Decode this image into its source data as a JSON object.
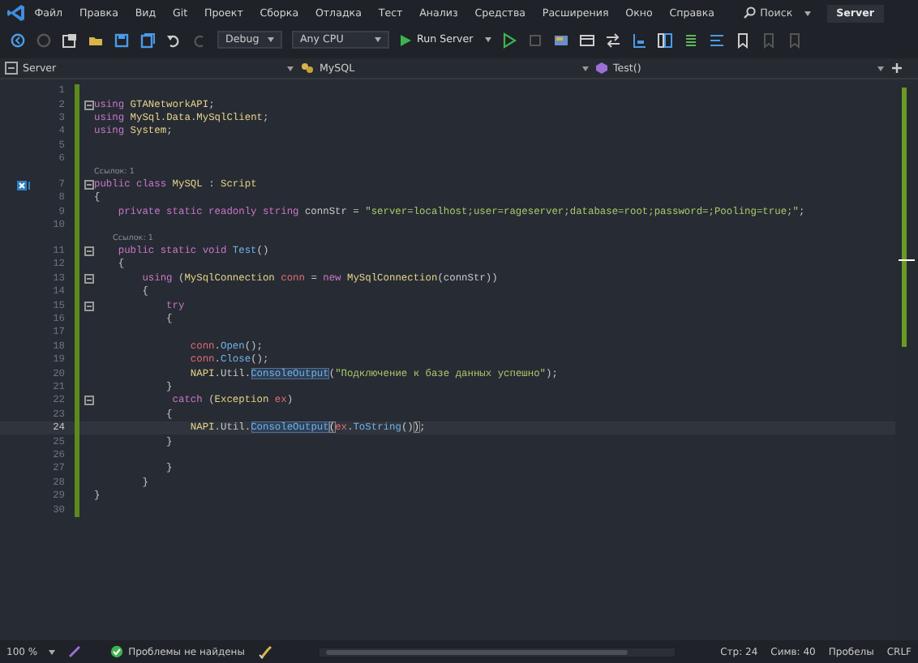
{
  "menu": [
    "Файл",
    "Правка",
    "Вид",
    "Git",
    "Проект",
    "Сборка",
    "Отладка",
    "Тест",
    "Анализ",
    "Средства",
    "Расширения",
    "Окно",
    "Справка"
  ],
  "search": {
    "label": "Поиск"
  },
  "solution_title": "Server",
  "toolbar": {
    "configuration": "Debug",
    "platform": "Any CPU",
    "run": "Run Server"
  },
  "navigation": {
    "project": "Server",
    "type": "MySQL",
    "member": "Test()"
  },
  "code_lines": [
    {
      "number": "1",
      "fold": false,
      "current": false
    },
    {
      "number": "2",
      "fold": true,
      "current": false,
      "tokens": [
        {
          "kind": "kw",
          "text": "using "
        },
        {
          "kind": "type",
          "text": "GTANetworkAPI"
        },
        {
          "kind": "punct",
          "text": ";"
        }
      ]
    },
    {
      "number": "3",
      "fold": false,
      "current": false,
      "tokens": [
        {
          "kind": "kw",
          "text": "using "
        },
        {
          "kind": "type",
          "text": "MySql"
        },
        {
          "kind": "punct",
          "text": "."
        },
        {
          "kind": "type",
          "text": "Data"
        },
        {
          "kind": "punct",
          "text": "."
        },
        {
          "kind": "type",
          "text": "MySqlClient"
        },
        {
          "kind": "punct",
          "text": ";"
        }
      ]
    },
    {
      "number": "4",
      "fold": false,
      "current": false,
      "tokens": [
        {
          "kind": "kw",
          "text": "using "
        },
        {
          "kind": "type",
          "text": "System"
        },
        {
          "kind": "punct",
          "text": ";"
        }
      ]
    },
    {
      "number": "5",
      "fold": false,
      "current": false
    },
    {
      "number": "6",
      "fold": false,
      "current": false
    },
    {
      "number": "7",
      "fold": true,
      "current": false,
      "lens": "Ссылок: 1",
      "marker": true,
      "tokens": [
        {
          "kind": "kw",
          "text": "public class "
        },
        {
          "kind": "type",
          "text": "MySQL"
        },
        {
          "kind": "punct",
          "text": " : "
        },
        {
          "kind": "type",
          "text": "Script"
        }
      ]
    },
    {
      "number": "8",
      "fold": false,
      "current": false,
      "tokens": [
        {
          "kind": "punct",
          "text": "{"
        }
      ]
    },
    {
      "number": "9",
      "fold": false,
      "current": false,
      "tokens": [
        {
          "kind": "kw",
          "text": "    private static readonly string "
        },
        {
          "kind": "field",
          "text": "connStr"
        },
        {
          "kind": "punct",
          "text": " = "
        },
        {
          "kind": "str",
          "text": "\"server=localhost;user=rageserver;database=root;password=;Pooling=true;\""
        },
        {
          "kind": "punct",
          "text": ";"
        }
      ]
    },
    {
      "number": "10",
      "fold": false,
      "current": false
    },
    {
      "number": "11",
      "fold": true,
      "current": false,
      "lens": "Ссылок: 1",
      "tokens": [
        {
          "kind": "kw",
          "text": "    public static void "
        },
        {
          "kind": "method",
          "text": "Test"
        },
        {
          "kind": "punct",
          "text": "()"
        }
      ]
    },
    {
      "number": "12",
      "fold": false,
      "current": false,
      "tokens": [
        {
          "kind": "punct",
          "text": "    {"
        }
      ]
    },
    {
      "number": "13",
      "fold": true,
      "current": false,
      "tokens": [
        {
          "kind": "kw",
          "text": "        using "
        },
        {
          "kind": "punct",
          "text": "("
        },
        {
          "kind": "type",
          "text": "MySqlConnection "
        },
        {
          "kind": "local",
          "text": "conn"
        },
        {
          "kind": "punct",
          "text": " = "
        },
        {
          "kind": "kw",
          "text": "new "
        },
        {
          "kind": "type",
          "text": "MySqlConnection"
        },
        {
          "kind": "punct",
          "text": "("
        },
        {
          "kind": "field",
          "text": "connStr"
        },
        {
          "kind": "punct",
          "text": "))"
        }
      ]
    },
    {
      "number": "14",
      "fold": false,
      "current": false,
      "tokens": [
        {
          "kind": "punct",
          "text": "        {"
        }
      ]
    },
    {
      "number": "15",
      "fold": true,
      "current": false,
      "tokens": [
        {
          "kind": "kw",
          "text": "            try"
        }
      ]
    },
    {
      "number": "16",
      "fold": false,
      "current": false,
      "tokens": [
        {
          "kind": "punct",
          "text": "            {"
        }
      ]
    },
    {
      "number": "17",
      "fold": false,
      "current": false
    },
    {
      "number": "18",
      "fold": false,
      "current": false,
      "tokens": [
        {
          "kind": "local",
          "text": "                conn"
        },
        {
          "kind": "punct",
          "text": "."
        },
        {
          "kind": "method",
          "text": "Open"
        },
        {
          "kind": "punct",
          "text": "();"
        }
      ]
    },
    {
      "number": "19",
      "fold": false,
      "current": false,
      "tokens": [
        {
          "kind": "local",
          "text": "                conn"
        },
        {
          "kind": "punct",
          "text": "."
        },
        {
          "kind": "method",
          "text": "Close"
        },
        {
          "kind": "punct",
          "text": "();"
        }
      ]
    },
    {
      "number": "20",
      "fold": false,
      "current": false,
      "tokens": [
        {
          "kind": "type",
          "text": "                NAPI"
        },
        {
          "kind": "punct",
          "text": "."
        },
        {
          "kind": "field",
          "text": "Util"
        },
        {
          "kind": "punct",
          "text": "."
        },
        {
          "kind": "ref",
          "text": "ConsoleOutput"
        },
        {
          "kind": "punct",
          "text": "("
        },
        {
          "kind": "str",
          "text": "\"Подключение к базе данных успешно\""
        },
        {
          "kind": "punct",
          "text": ");"
        }
      ]
    },
    {
      "number": "21",
      "fold": false,
      "current": false,
      "tokens": [
        {
          "kind": "punct",
          "text": "            }"
        }
      ]
    },
    {
      "number": "22",
      "fold": true,
      "current": false,
      "tokens": [
        {
          "kind": "kw",
          "text": "             catch "
        },
        {
          "kind": "punct",
          "text": "("
        },
        {
          "kind": "type",
          "text": "Exception "
        },
        {
          "kind": "local",
          "text": "ex"
        },
        {
          "kind": "punct",
          "text": ")"
        }
      ]
    },
    {
      "number": "23",
      "fold": false,
      "current": false,
      "tokens": [
        {
          "kind": "punct",
          "text": "            {"
        }
      ]
    },
    {
      "number": "24",
      "fold": false,
      "current": true,
      "tokens": [
        {
          "kind": "type",
          "text": "                NAPI"
        },
        {
          "kind": "punct",
          "text": "."
        },
        {
          "kind": "field",
          "text": "Util"
        },
        {
          "kind": "punct",
          "text": "."
        },
        {
          "kind": "ref",
          "text": "ConsoleOutput"
        },
        {
          "kind": "brace",
          "text": "("
        },
        {
          "kind": "local",
          "text": "ex"
        },
        {
          "kind": "punct",
          "text": "."
        },
        {
          "kind": "method",
          "text": "ToString"
        },
        {
          "kind": "punct",
          "text": "()"
        },
        {
          "kind": "brace",
          "text": ")"
        },
        {
          "kind": "punct",
          "text": ";"
        }
      ]
    },
    {
      "number": "25",
      "fold": false,
      "current": false,
      "tokens": [
        {
          "kind": "punct",
          "text": "            }"
        }
      ]
    },
    {
      "number": "26",
      "fold": false,
      "current": false
    },
    {
      "number": "27",
      "fold": false,
      "current": false,
      "tokens": [
        {
          "kind": "punct",
          "text": "            }"
        }
      ]
    },
    {
      "number": "28",
      "fold": false,
      "current": false,
      "tokens": [
        {
          "kind": "punct",
          "text": "        }"
        }
      ]
    },
    {
      "number": "29",
      "fold": false,
      "current": false,
      "tokens": [
        {
          "kind": "punct",
          "text": "}"
        }
      ]
    },
    {
      "number": "30",
      "fold": false,
      "current": false
    }
  ],
  "status_bar": {
    "zoom": "100 %",
    "issues": "Проблемы не найдены",
    "line": "Стр: 24",
    "column": "Симв: 40",
    "whitespace": "Пробелы",
    "line_ending": "CRLF"
  }
}
